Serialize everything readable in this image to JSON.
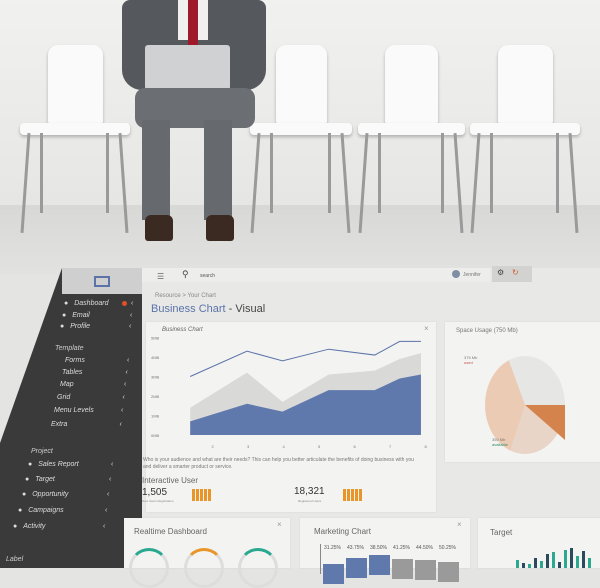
{
  "topbar": {
    "search_placeholder": "search",
    "user": "Jennifer"
  },
  "breadcrumb": "Resource > Your Chart",
  "page_title": {
    "main": "Business Chart",
    "sub": "- Visual"
  },
  "sidebar": {
    "items": [
      {
        "label": "Dashboard",
        "icon": "dashboard-icon",
        "badge": "F"
      },
      {
        "label": "Email",
        "icon": "email-icon"
      },
      {
        "label": "Profile",
        "icon": "profile-icon"
      }
    ],
    "template_head": "Template",
    "template_items": [
      "Forms",
      "Tables",
      "Map",
      "Grid",
      "Menu Levels",
      "Extra"
    ],
    "project_head": "Project",
    "project_items": [
      {
        "label": "Sales Report",
        "icon": "report-icon"
      },
      {
        "label": "Target",
        "icon": "target-icon"
      },
      {
        "label": "Opportunity",
        "icon": "rocket-icon"
      },
      {
        "label": "Campaigns",
        "icon": "campaign-icon"
      },
      {
        "label": "Activity",
        "icon": "chat-icon"
      }
    ],
    "label_head": "Label"
  },
  "business_chart": {
    "title": "Business Chart",
    "description": "Who is your audience and what are their needs? This can help you better articulate the benefits of doing business with you and deliver a smarter product or service."
  },
  "chart_data": {
    "type": "area",
    "title": "Business Chart",
    "x": [
      1.4,
      3,
      4,
      5.3,
      6.6,
      7.3,
      7.9
    ],
    "xticks": [
      "2",
      "3",
      "4",
      "5",
      "6",
      "7",
      "8"
    ],
    "yticks": [
      "0MB",
      "1MB",
      "2MB",
      "3MB",
      "4MB",
      "5MB"
    ],
    "ylim": [
      0,
      5
    ],
    "series": [
      {
        "type": "line",
        "values": [
          3.0,
          4.3,
          3.8,
          4.4,
          4.1,
          4.8,
          4.8
        ],
        "color": "#5b73a8"
      },
      {
        "type": "area",
        "values": [
          1.4,
          3.2,
          1.7,
          3.1,
          3.3,
          3.9,
          4.2
        ],
        "color": "#d9d9d8"
      },
      {
        "type": "area",
        "values": [
          0.7,
          1.6,
          1.2,
          2.3,
          2.3,
          2.9,
          3.1
        ],
        "color": "#6079ad"
      }
    ]
  },
  "interactive_user": {
    "title": "Interactive User",
    "stat1": {
      "value": "1,505",
      "label": "New Users Registration"
    },
    "stat2": {
      "value": "18,321",
      "label": "Registered Users"
    }
  },
  "space_usage": {
    "title": "Space Usage (750 Mb)",
    "used": "375 Mb",
    "used_label": "used",
    "avail": "350 Mb",
    "avail_label": "available"
  },
  "realtime": {
    "title": "Realtime Dashboard"
  },
  "marketing": {
    "title": "Marketing Chart",
    "labels": [
      "31.25%",
      "43.75%",
      "38.50%",
      "41.25%",
      "44.50%",
      "50.25%"
    ]
  },
  "target": {
    "title": "Target"
  },
  "colors": {
    "accent": "#5b73a8",
    "orange": "#e8962a",
    "teal": "#2aa890"
  }
}
